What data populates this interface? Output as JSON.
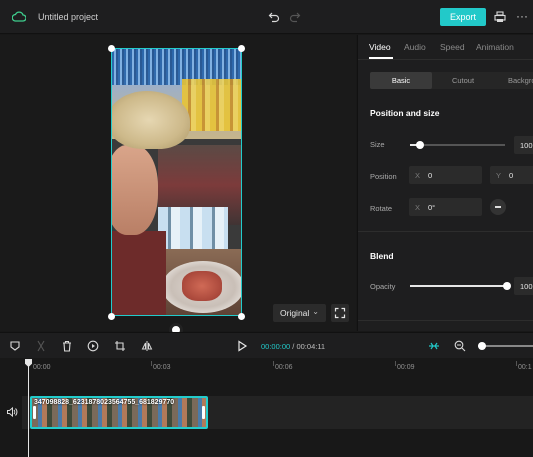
{
  "header": {
    "project_title": "Untitled project",
    "export_label": "Export",
    "more_label": "···"
  },
  "preview": {
    "ratio_label": "Original",
    "ratio_chevron": "⌄"
  },
  "panel": {
    "tabs": [
      "Video",
      "Audio",
      "Speed",
      "Animation"
    ],
    "active_tab": "Video",
    "subtabs": [
      "Basic",
      "Cutout",
      "Background"
    ],
    "active_subtab": "Basic",
    "position_section": {
      "title": "Position and size",
      "size_label": "Size",
      "size_value": "100",
      "size_fraction": 0.1,
      "position_label": "Position",
      "x_prefix": "X",
      "x_value": "0",
      "y_prefix": "Y",
      "y_value": "0",
      "rotate_label": "Rotate",
      "rotate_prefix": "X",
      "rotate_value": "0°"
    },
    "blend_section": {
      "title": "Blend",
      "opacity_label": "Opacity",
      "opacity_value": "100",
      "opacity_fraction": 1.0
    }
  },
  "timeline_toolbar": {
    "current_time": "00:00:00",
    "separator": " / ",
    "total_time": "00:04:11"
  },
  "timeline": {
    "ruler": [
      "00:00",
      "00:03",
      "00:06",
      "00:09",
      "00:1"
    ],
    "clip_name": "347098828_6231878023564755_681829770"
  },
  "colors": {
    "accent": "#22c9c9",
    "background": "#181818",
    "panel": "#1e1e1f"
  }
}
